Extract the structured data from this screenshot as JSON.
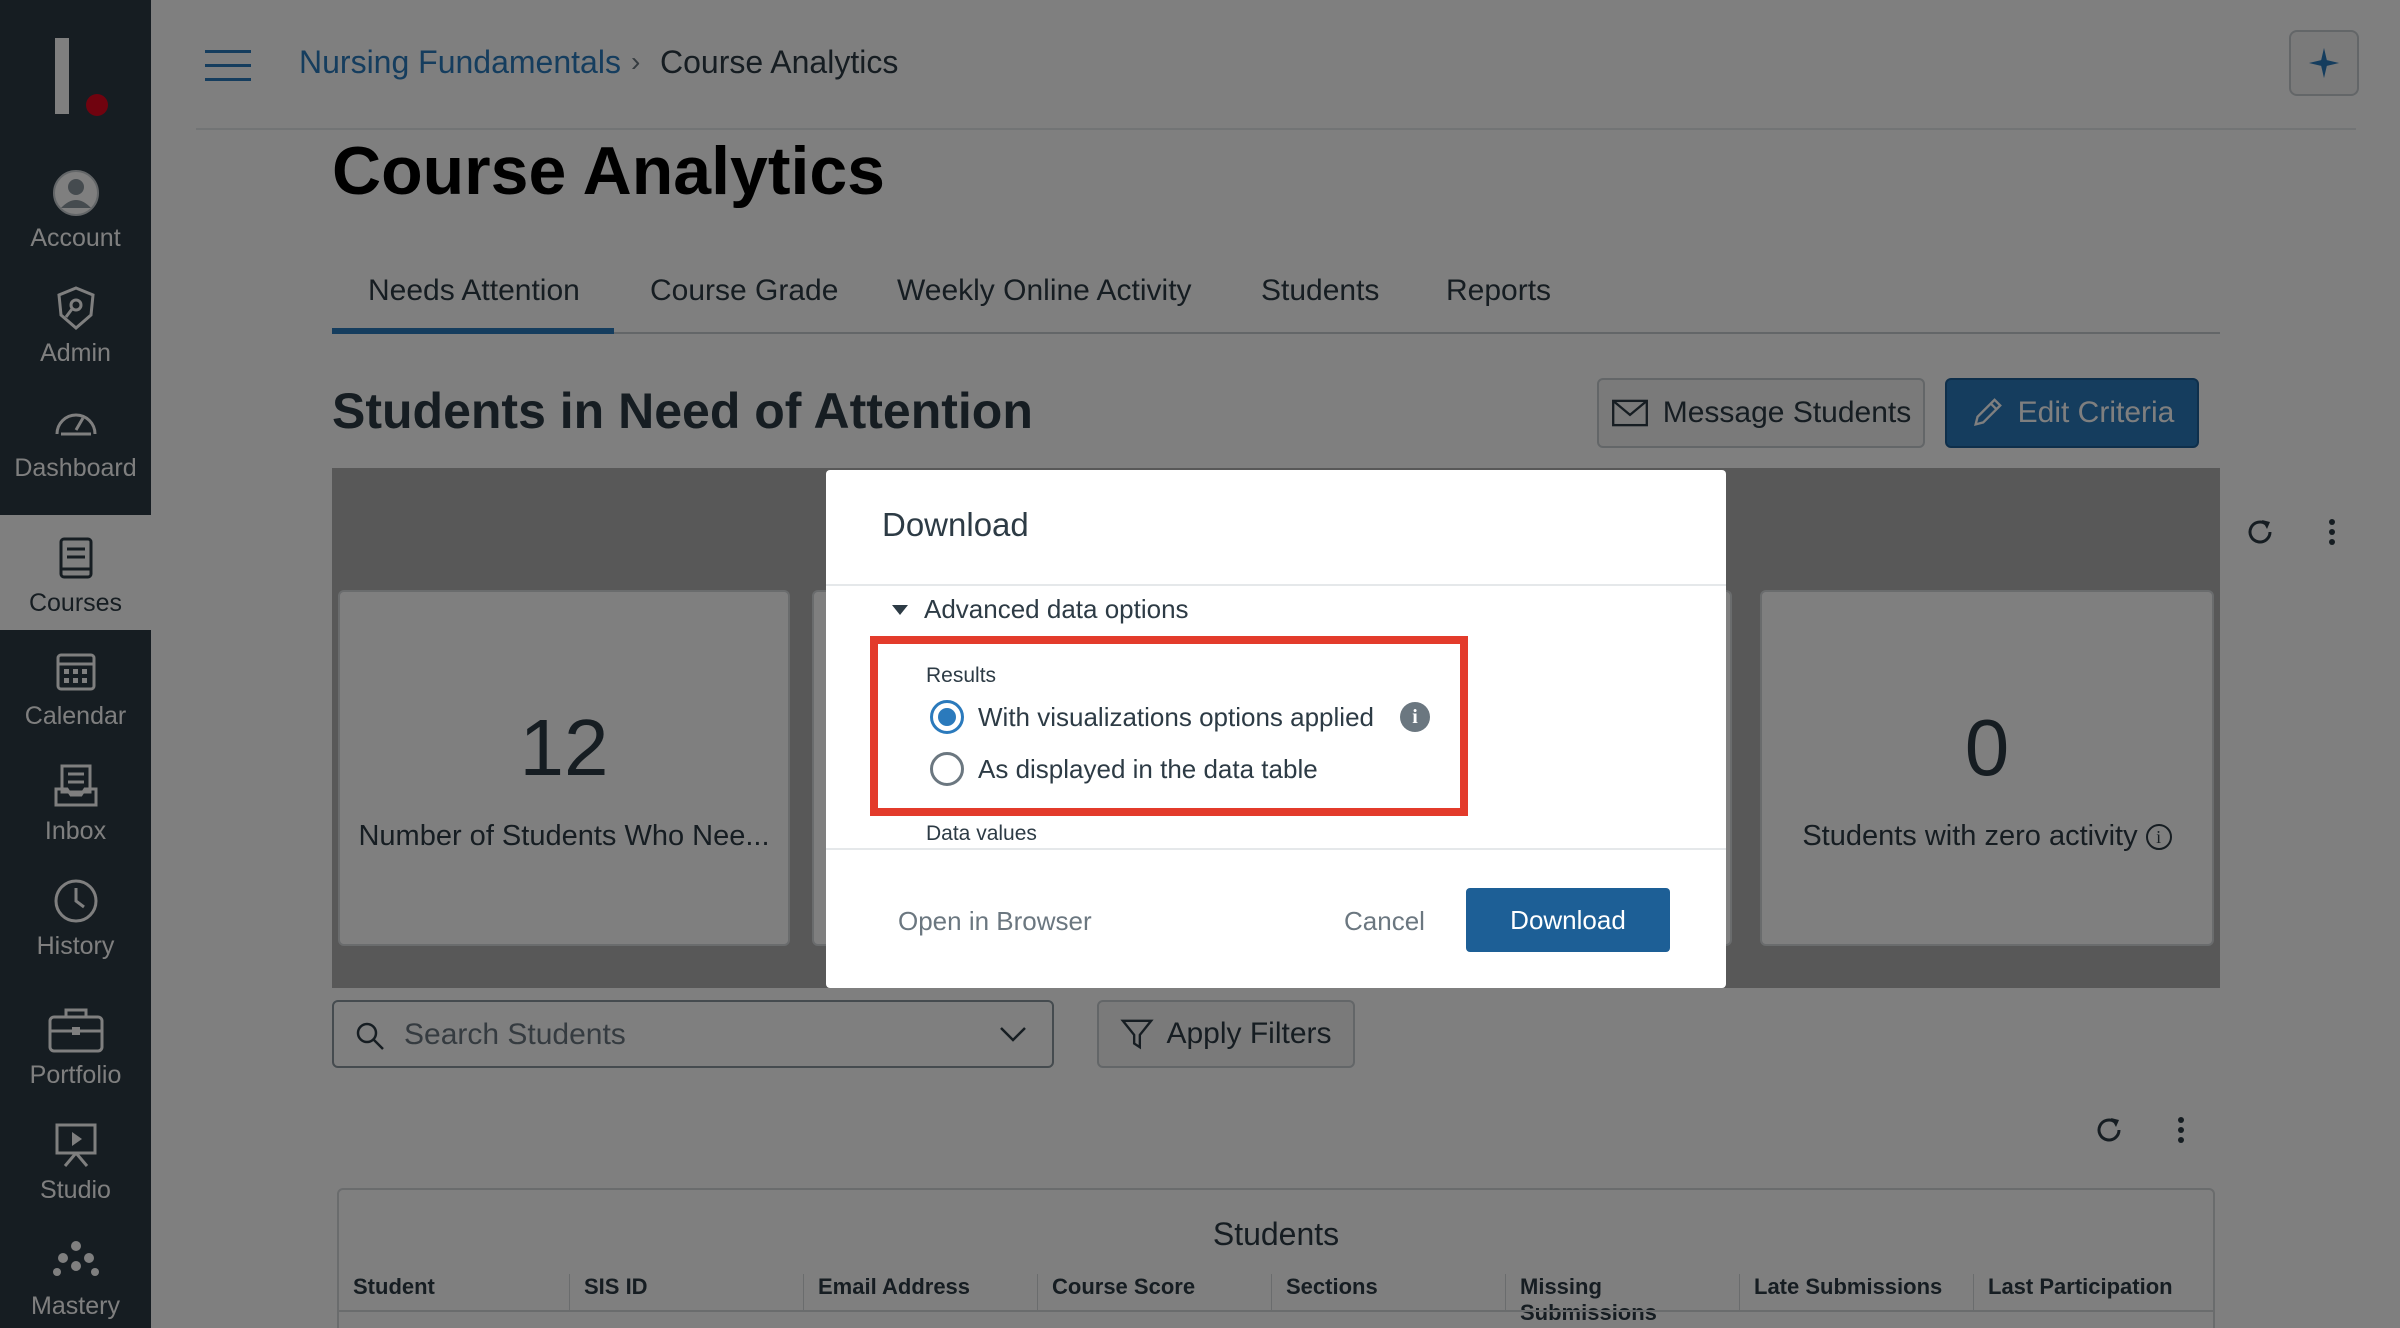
{
  "nav": {
    "items": [
      {
        "label": "Account",
        "icon": "account-icon"
      },
      {
        "label": "Admin",
        "icon": "admin-icon"
      },
      {
        "label": "Dashboard",
        "icon": "dashboard-icon"
      },
      {
        "label": "Courses",
        "icon": "courses-icon"
      },
      {
        "label": "Calendar",
        "icon": "calendar-icon"
      },
      {
        "label": "Inbox",
        "icon": "inbox-icon"
      },
      {
        "label": "History",
        "icon": "history-icon"
      },
      {
        "label": "Portfolio",
        "icon": "portfolio-icon"
      },
      {
        "label": "Studio",
        "icon": "studio-icon"
      },
      {
        "label": "Mastery",
        "icon": "mastery-icon"
      }
    ],
    "active": "Courses"
  },
  "header": {
    "breadcrumb_link": "Nursing Fundamentals",
    "breadcrumb_separator": "›",
    "breadcrumb_current": "Course Analytics"
  },
  "page": {
    "title": "Course Analytics",
    "tabs": [
      "Needs Attention",
      "Course Grade",
      "Weekly Online Activity",
      "Students",
      "Reports"
    ],
    "active_tab": "Needs Attention",
    "section_title": "Students in Need of Attention",
    "message_button": "Message Students",
    "edit_button": "Edit Criteria"
  },
  "cards": [
    {
      "value": "12",
      "label": "Number of Students Who Nee..."
    },
    {
      "value": "0",
      "label": "Students with zero activity"
    }
  ],
  "search": {
    "placeholder": "Search Students"
  },
  "filters_button": "Apply Filters",
  "table": {
    "title": "Students",
    "columns": [
      "Student",
      "SIS ID",
      "Email Address",
      "Course Score",
      "Sections",
      "Missing Submissions",
      "Late Submissions",
      "Last Participation"
    ]
  },
  "dialog": {
    "title": "Download",
    "advanced_toggle": "Advanced data options",
    "results_label": "Results",
    "options": [
      {
        "label": "With visualizations options applied",
        "checked": true
      },
      {
        "label": "As displayed in the data table",
        "checked": false
      }
    ],
    "data_values_label": "Data values",
    "open_browser": "Open in Browser",
    "cancel": "Cancel",
    "download": "Download"
  },
  "colors": {
    "nav_bg": "#2d3b45",
    "brand_blue": "#2b7abc",
    "highlight_red": "#e33b2b",
    "download_blue": "#1d5f96"
  }
}
